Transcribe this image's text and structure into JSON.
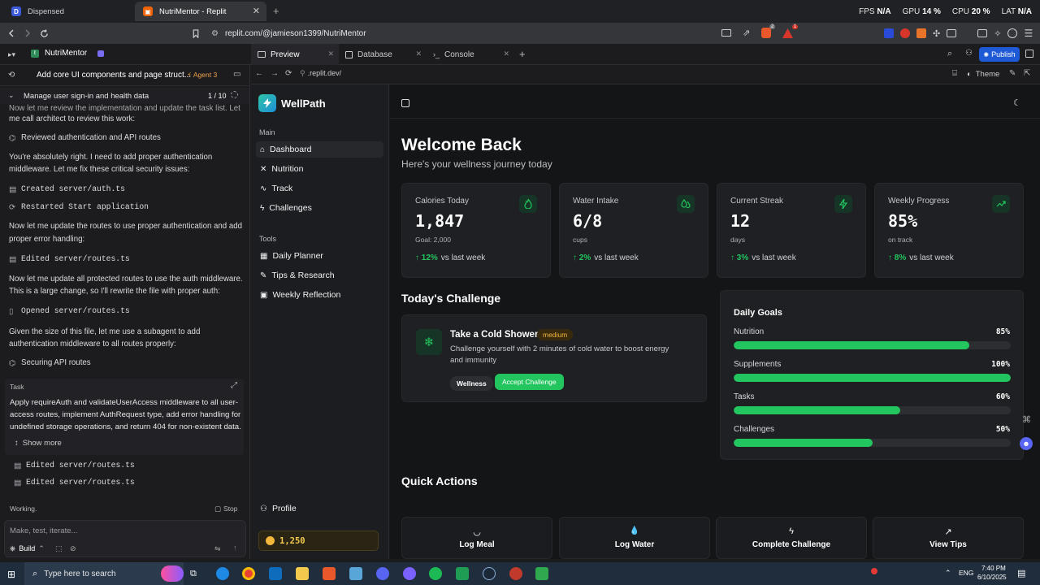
{
  "browser": {
    "tabs": [
      {
        "label": "Dispensed"
      },
      {
        "label": "NutriMentor - Replit"
      }
    ],
    "hud": [
      {
        "label": "FPS",
        "value": "N/A"
      },
      {
        "label": "GPU",
        "value": "14 %"
      },
      {
        "label": "CPU",
        "value": "20 %"
      },
      {
        "label": "LAT",
        "value": "N/A"
      }
    ],
    "url": "replit.com/@jamieson1399/NutriMentor",
    "ext_badge": "1"
  },
  "replit": {
    "project": "NutriMentor",
    "tabs": [
      {
        "label": "Preview"
      },
      {
        "label": "Database"
      },
      {
        "label": "Console"
      }
    ],
    "publish": "Publish",
    "preview_url": ".replit.dev/",
    "theme_label": "Theme"
  },
  "agent": {
    "title": "Add core UI components and page struct...",
    "agent_badge": "Agent 3",
    "progress_label": "Manage user sign-in and health data",
    "progress": "1 / 10",
    "lines": {
      "l0": "Now let me review the implementation and update the task list. Let",
      "l1": "me call architect to review this work:",
      "a1": "Reviewed authentication and API routes",
      "l2": "You're absolutely right. I need to add proper authentication",
      "l3": "middleware. Let me fix these critical security issues:",
      "a2": "Created server/auth.ts",
      "a3": "Restarted Start application",
      "l4": "Now let me update the routes to use proper authentication and add",
      "l5": "proper error handling:",
      "a4": "Edited server/routes.ts",
      "l6": "Now let me update all protected routes to use the auth middleware.",
      "l7": "This is a large change, so I'll rewrite the file with proper auth:",
      "a5": "Opened server/routes.ts",
      "l8": "Given the size of this file, let me use a subagent to add",
      "l9": "authentication middleware to all routes properly:",
      "a6": "Securing API routes"
    },
    "task": {
      "label": "Task",
      "t1": "Apply requireAuth and validateUserAccess middleware to all user-",
      "t2": "access routes, implement AuthRequest type, add error handling for",
      "t3": "undefined storage operations, and return 404 for non-existent data.",
      "show_more": "Show more"
    },
    "edits": [
      "Edited server/routes.ts",
      "Edited server/routes.ts"
    ],
    "status": "Working.",
    "stop": "Stop",
    "input_placeholder": "Make, test, iterate...",
    "build": "Build"
  },
  "app": {
    "brand": "WellPath",
    "sections": {
      "main": "Main",
      "tools": "Tools"
    },
    "nav_main": [
      "Dashboard",
      "Nutrition",
      "Track",
      "Challenges"
    ],
    "nav_tools": [
      "Daily Planner",
      "Tips & Research",
      "Weekly Reflection"
    ],
    "profile": "Profile",
    "points": "1,250",
    "heading": "Welcome Back",
    "subheading": "Here's your wellness journey today",
    "stats": [
      {
        "label": "Calories Today",
        "value": "1,847",
        "sub": "Goal: 2,000",
        "trend": "12%",
        "trend_text": "vs last week",
        "icon": "flame-icon"
      },
      {
        "label": "Water Intake",
        "value": "6/8",
        "sub": "cups",
        "trend": "2%",
        "trend_text": "vs last week",
        "icon": "droplets-icon"
      },
      {
        "label": "Current Streak",
        "value": "12",
        "sub": "days",
        "trend": "3%",
        "trend_text": "vs last week",
        "icon": "zap-icon"
      },
      {
        "label": "Weekly Progress",
        "value": "85%",
        "sub": "on track",
        "trend": "8%",
        "trend_text": "vs last week",
        "icon": "trending-up-icon"
      }
    ],
    "challenge": {
      "section_title": "Today's Challenge",
      "title": "Take a Cold Shower",
      "difficulty": "medium",
      "desc1": "Challenge yourself with 2 minutes of cold water to boost energy",
      "desc2": "and immunity",
      "tag": "Wellness",
      "accept": "Accept Challenge"
    },
    "goals": {
      "title": "Daily Goals",
      "items": [
        {
          "label": "Nutrition",
          "pct_text": "85%",
          "pct": 0.85
        },
        {
          "label": "Supplements",
          "pct_text": "100%",
          "pct": 1.0
        },
        {
          "label": "Tasks",
          "pct_text": "60%",
          "pct": 0.6
        },
        {
          "label": "Challenges",
          "pct_text": "50%",
          "pct": 0.5
        }
      ]
    },
    "quick_actions": {
      "title": "Quick Actions",
      "items": [
        "Log Meal",
        "Log Water",
        "Complete Challenge",
        "View Tips"
      ]
    }
  },
  "taskbar": {
    "search_placeholder": "Type here to search",
    "lang": "ENG",
    "time": "7:40 PM",
    "date": "6/10/2025"
  },
  "colors": {
    "accent": "#22c55e",
    "publish": "#1e5ad6",
    "brand_icon": "#2ec4a8"
  }
}
